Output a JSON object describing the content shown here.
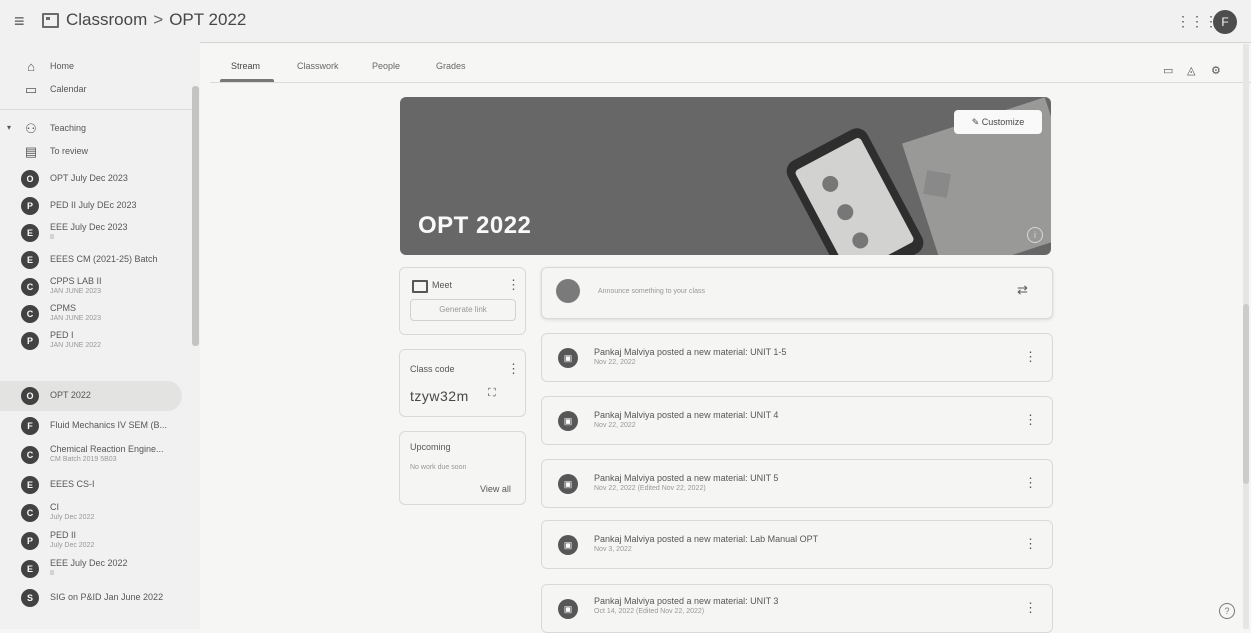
{
  "header": {
    "app_name": "Classroom",
    "separator": ">",
    "class_name": "OPT 2022",
    "avatar_initial": "F"
  },
  "sidebar": {
    "nav": [
      {
        "label": "Home",
        "icon": "home-icon"
      },
      {
        "label": "Calendar",
        "icon": "calendar-icon"
      },
      {
        "label": "Teaching",
        "icon": "teaching-icon"
      },
      {
        "label": "To review",
        "icon": "to-review-icon"
      }
    ],
    "classes": [
      {
        "initial": "O",
        "name": "OPT July Dec 2023",
        "sub": ""
      },
      {
        "initial": "P",
        "name": "PED II July DEc 2023",
        "sub": ""
      },
      {
        "initial": "E",
        "name": "EEE July Dec 2023",
        "sub": "II"
      },
      {
        "initial": "E",
        "name": "EEES CM (2021-25) Batch",
        "sub": ""
      },
      {
        "initial": "C",
        "name": "CPPS LAB II",
        "sub": "JAN JUNE 2023"
      },
      {
        "initial": "C",
        "name": "CPMS",
        "sub": "JAN JUNE 2023"
      },
      {
        "initial": "P",
        "name": "PED I",
        "sub": "JAN JUNE 2022"
      },
      {
        "initial": "O",
        "name": "OPT 2022",
        "sub": ""
      },
      {
        "initial": "F",
        "name": "Fluid Mechanics IV SEM (B...",
        "sub": ""
      },
      {
        "initial": "C",
        "name": "Chemical Reaction Engine...",
        "sub": "CM Batch 2019 5B03"
      },
      {
        "initial": "E",
        "name": "EEES CS-I",
        "sub": ""
      },
      {
        "initial": "C",
        "name": "CI",
        "sub": "July Dec 2022"
      },
      {
        "initial": "P",
        "name": "PED II",
        "sub": "July Dec 2022"
      },
      {
        "initial": "E",
        "name": "EEE July Dec 2022",
        "sub": "II"
      },
      {
        "initial": "S",
        "name": "SIG on P&ID Jan June 2022",
        "sub": ""
      }
    ]
  },
  "tabs": [
    {
      "label": "Stream"
    },
    {
      "label": "Classwork"
    },
    {
      "label": "People"
    },
    {
      "label": "Grades"
    }
  ],
  "banner": {
    "title": "OPT 2022",
    "customize_label": "Customize"
  },
  "meet": {
    "label": "Meet",
    "generate_link_label": "Generate link"
  },
  "class_code": {
    "label": "Class code",
    "code": "tzyw32m"
  },
  "upcoming": {
    "label": "Upcoming",
    "empty_text": "No work due soon",
    "view_all_label": "View all"
  },
  "announce": {
    "placeholder": "Announce something to your class"
  },
  "posts": [
    {
      "title": "Pankaj Malviya posted a new material: UNIT 1-5",
      "date": "Nov 22, 2022"
    },
    {
      "title": "Pankaj Malviya posted a new material: UNIT 4",
      "date": "Nov 22, 2022"
    },
    {
      "title": "Pankaj Malviya posted a new material: UNIT 5",
      "date": "Nov 22, 2022 (Edited Nov 22, 2022)"
    },
    {
      "title": "Pankaj Malviya posted a new material: Lab Manual OPT",
      "date": "Nov 3, 2022"
    },
    {
      "title": "Pankaj Malviya posted a new material: UNIT 3",
      "date": "Oct 14, 2022 (Edited Nov 22, 2022)"
    }
  ],
  "icons": {
    "menu": "menu-icon",
    "apps": "apps-icon",
    "calendar_top": "calendar-icon",
    "drive": "drive-icon",
    "settings": "settings-icon",
    "help": "help-icon"
  }
}
